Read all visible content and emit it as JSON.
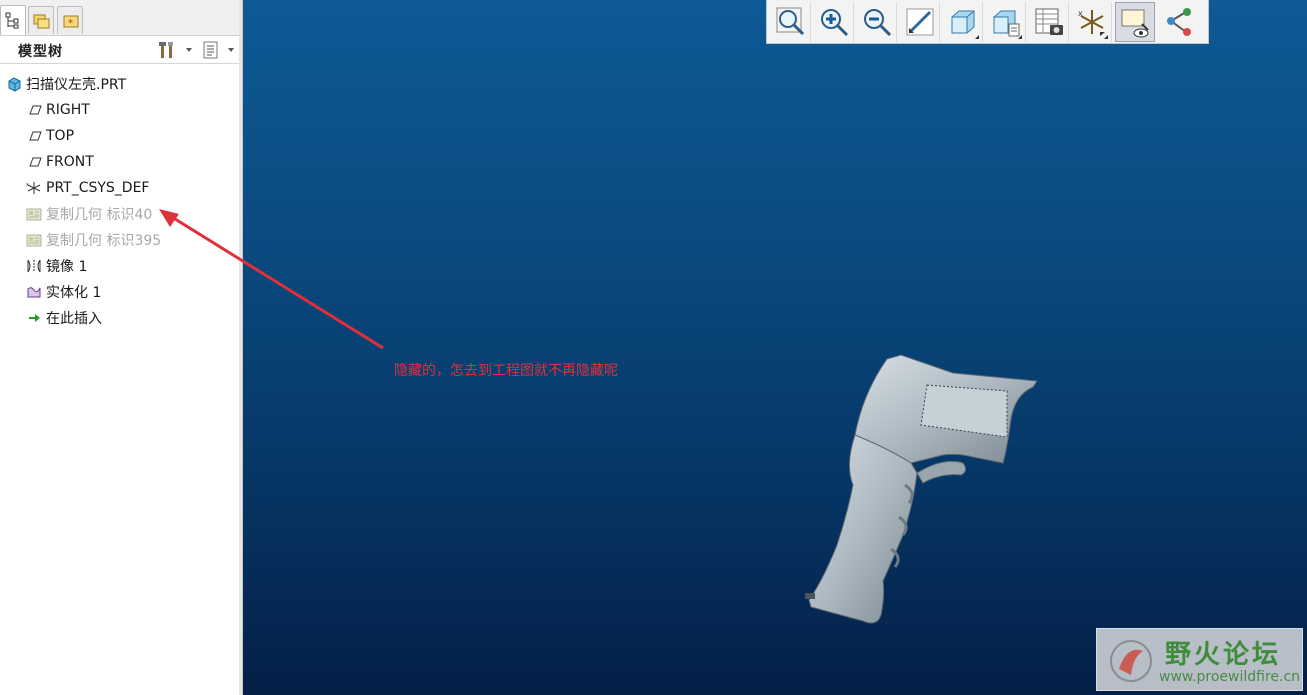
{
  "tabs": [
    {
      "name": "model-tree-tab",
      "icon": "model-tree-icon"
    },
    {
      "name": "folder-browser-tab",
      "icon": "folders-icon"
    },
    {
      "name": "favorites-tab",
      "icon": "favorites-icon"
    }
  ],
  "tree_header": {
    "title": "模型树",
    "settings_icon": "tools-icon",
    "show_icon": "list-view-icon"
  },
  "tree": {
    "root": "扫描仪左壳.PRT",
    "items": [
      {
        "label": "RIGHT",
        "icon": "datum-plane-icon",
        "hidden": false
      },
      {
        "label": "TOP",
        "icon": "datum-plane-icon",
        "hidden": false
      },
      {
        "label": "FRONT",
        "icon": "datum-plane-icon",
        "hidden": false
      },
      {
        "label": "PRT_CSYS_DEF",
        "icon": "coordinate-system-icon",
        "hidden": false
      },
      {
        "label": "复制几何 标识40",
        "icon": "copy-geometry-icon",
        "hidden": true
      },
      {
        "label": "复制几何 标识395",
        "icon": "copy-geometry-icon",
        "hidden": true
      },
      {
        "label": "镜像 1",
        "icon": "mirror-icon",
        "hidden": false
      },
      {
        "label": "实体化 1",
        "icon": "solidify-icon",
        "hidden": false
      },
      {
        "label": "在此插入",
        "icon": "insert-here-arrow-icon",
        "hidden": false
      }
    ]
  },
  "toolbar": [
    "refit-zoom-icon",
    "zoom-in-icon",
    "zoom-out-icon",
    "repaint-icon",
    "display-style-icon",
    "saved-views-icon",
    "view-manager-icon",
    "datum-display-icon",
    "annotation-display-icon",
    "spin-center-icon"
  ],
  "annotation": {
    "text": "隐藏的，怎去到工程图就不再隐藏呢",
    "color": "#e0303a"
  },
  "watermark": {
    "title": "野火论坛",
    "url": "www.proewildfire.cn"
  },
  "colors": {
    "viewport_top": "#0d5a96",
    "viewport_bottom": "#041f46",
    "model": "#b8c2c9"
  }
}
